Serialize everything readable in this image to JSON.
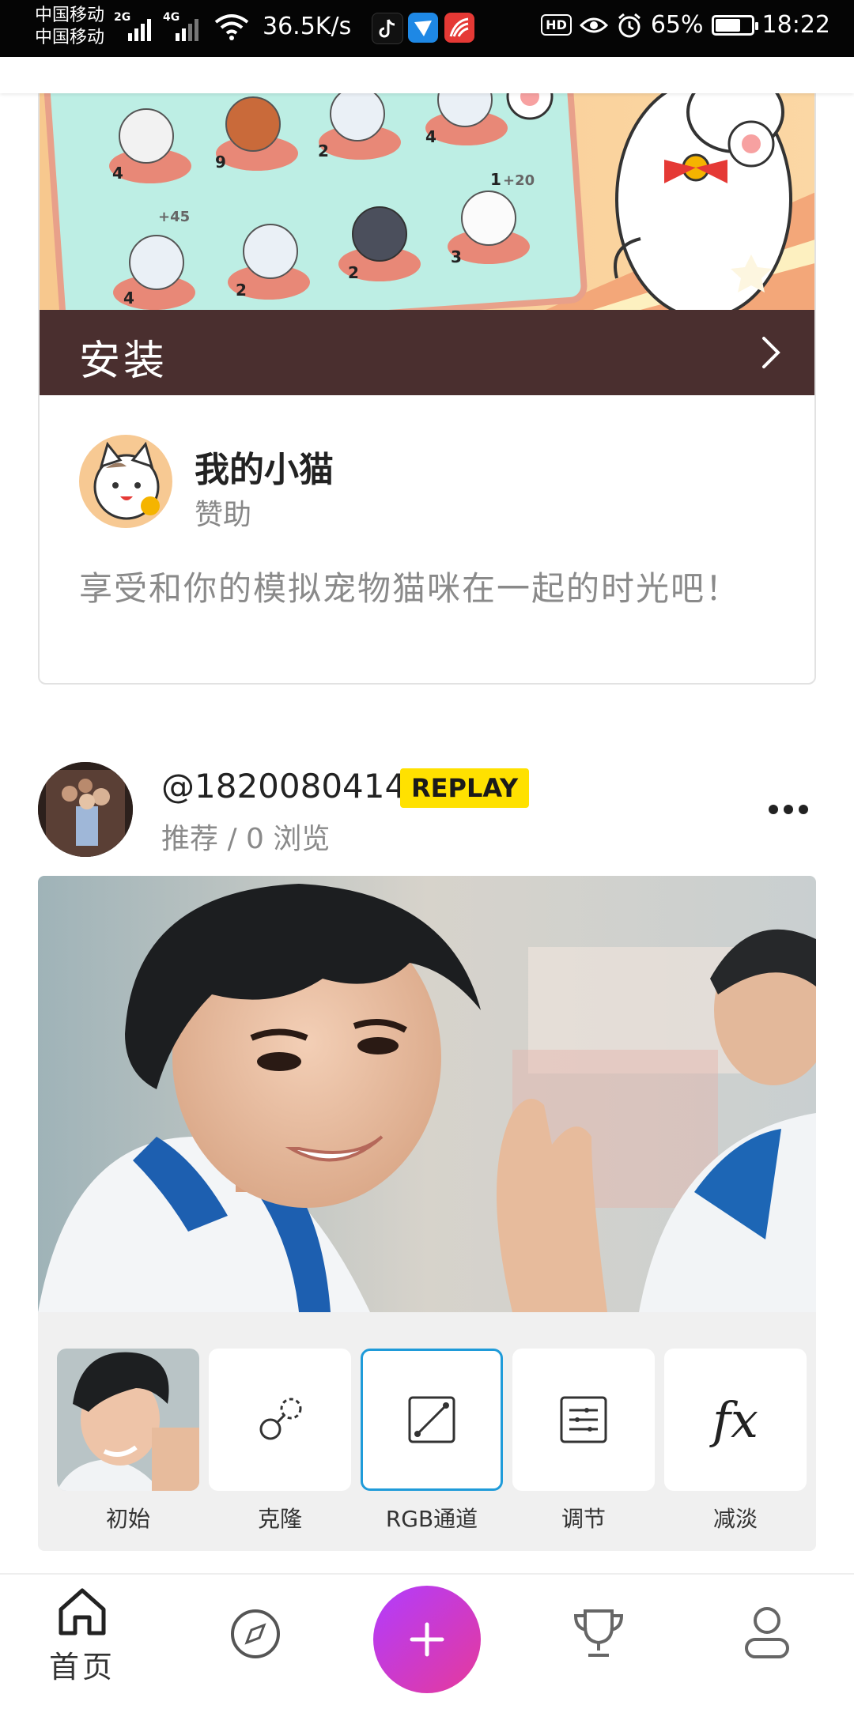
{
  "status_bar": {
    "carrier_1": "中国移动",
    "carrier_2": "中国移动",
    "net_1": "2G",
    "net_2": "4G",
    "speed": "36.5K/s",
    "hd": "HD",
    "battery_percent": "65%",
    "battery_level": 0.65,
    "time": "18:22"
  },
  "ad": {
    "install_label": "安装",
    "app_name": "我的小猫",
    "sponsor_label": "赞助",
    "description": "享受和你的模拟宠物猫咪在一起的时光吧！",
    "banner_numbers": [
      "4",
      "9",
      "2",
      "4",
      "4",
      "2",
      "2",
      "3",
      "1"
    ],
    "banner_bonus_1": "+45",
    "banner_bonus_2": "+20"
  },
  "post": {
    "username": "@1820080414",
    "badge": "REPLAY",
    "meta": "推荐 / 0 浏览",
    "tools": [
      {
        "label": "初始",
        "icon": "photo-thumbnail"
      },
      {
        "label": "克隆",
        "icon": "clone-icon"
      },
      {
        "label": "RGB通道",
        "icon": "rgb-curve-icon"
      },
      {
        "label": "调节",
        "icon": "adjust-icon"
      },
      {
        "label": "减淡",
        "icon": "fx-icon"
      }
    ],
    "selected_tool": "RGB通道"
  },
  "bottom_nav": {
    "home_label": "首页",
    "items": [
      "home-icon",
      "compass-icon",
      "plus-icon",
      "trophy-icon",
      "profile-icon"
    ],
    "fab_gradient": [
      "#b13cff",
      "#e6399b"
    ]
  },
  "colors": {
    "install_bar": "#4a2f2f",
    "badge": "#ffe100",
    "selected_border": "#1f9bd9"
  }
}
